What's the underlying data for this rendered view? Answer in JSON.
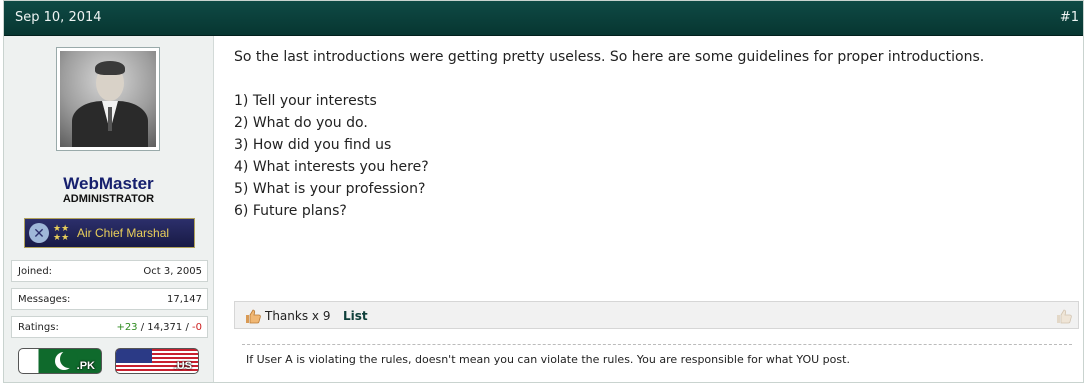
{
  "post": {
    "date": "Sep 10, 2014",
    "number": "#1"
  },
  "user": {
    "name": "WebMaster",
    "title": "ADMINISTRATOR",
    "rank": "Air Chief Marshal",
    "stats": [
      {
        "label": "Joined:",
        "value": "Oct 3, 2005"
      },
      {
        "label": "Messages:",
        "value": "17,147"
      }
    ],
    "ratings": {
      "label": "Ratings:",
      "positive": "+23",
      "sep1": " / ",
      "total": "14,371",
      "sep2": " / ",
      "negative": "-0"
    },
    "flags": [
      {
        "code": ".PK",
        "icon": "pakistan-flag-icon"
      },
      {
        "code": ".US",
        "icon": "usa-flag-icon"
      }
    ]
  },
  "message": {
    "intro": "So the last introductions were getting pretty useless. So here are some guidelines for proper introductions.",
    "items": [
      "1) Tell your interests",
      "2) What do you do.",
      "3) How did you find us",
      "4) What interests you here?",
      "5) What is your profession?",
      "6) Future plans?"
    ]
  },
  "thanks": {
    "text": "Thanks x 9",
    "list_label": "List",
    "icon": "thumbs-up-icon"
  },
  "signature": "If User A is violating the rules, doesn't mean you can violate the rules. You are responsible for what YOU post."
}
